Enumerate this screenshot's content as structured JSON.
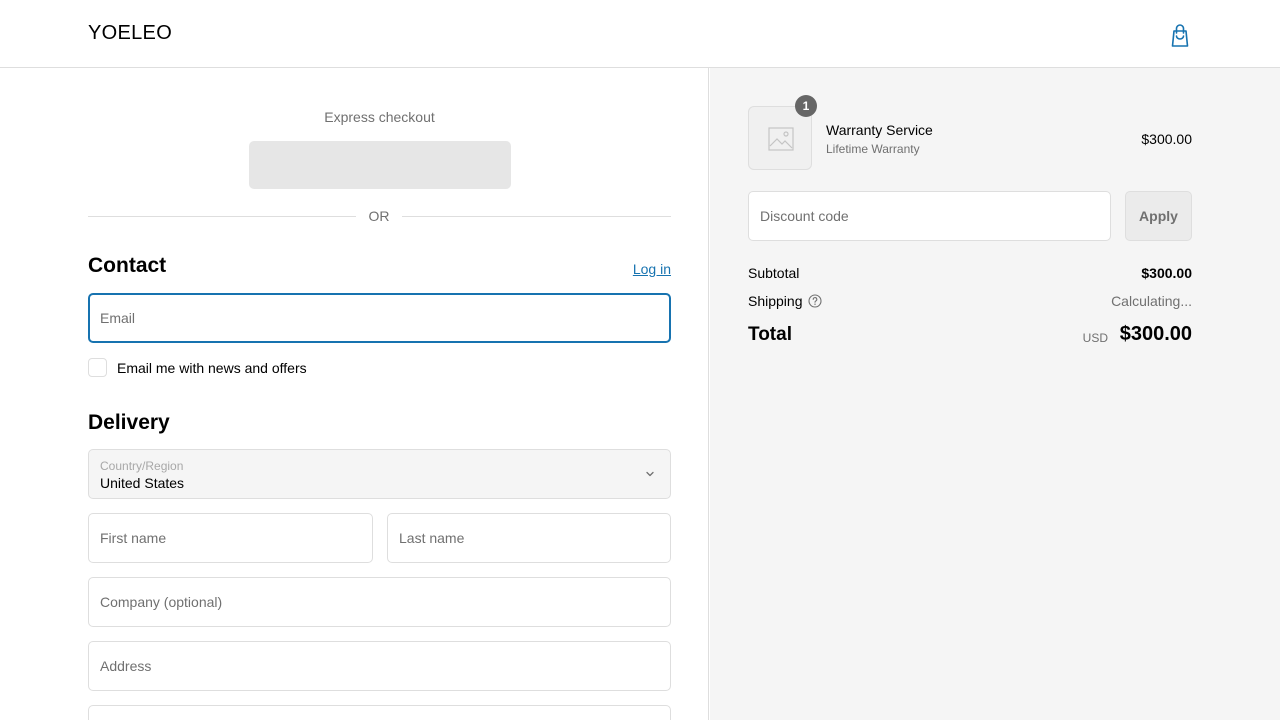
{
  "header": {
    "brand": "YOELEO",
    "cart_icon": "shopping-bag-icon"
  },
  "express": {
    "title": "Express checkout",
    "divider_text": "OR"
  },
  "contact": {
    "title": "Contact",
    "login_label": "Log in",
    "email_placeholder": "Email",
    "newsletter_label": "Email me with news and offers"
  },
  "delivery": {
    "title": "Delivery",
    "country_label": "Country/Region",
    "country_value": "United States",
    "first_name_placeholder": "First name",
    "last_name_placeholder": "Last name",
    "company_placeholder": "Company (optional)",
    "address_placeholder": "Address"
  },
  "summary": {
    "item": {
      "quantity": "1",
      "name": "Warranty Service",
      "variant": "Lifetime Warranty",
      "price": "$300.00",
      "image_icon": "image-placeholder-icon"
    },
    "discount_placeholder": "Discount code",
    "apply_label": "Apply",
    "subtotal_label": "Subtotal",
    "subtotal_value": "$300.00",
    "shipping_label": "Shipping",
    "shipping_value": "Calculating...",
    "total_label": "Total",
    "currency": "USD",
    "total_value": "$300.00"
  },
  "colors": {
    "accent": "#1773b0",
    "summary_bg": "#f5f5f5",
    "border": "#dedede"
  }
}
